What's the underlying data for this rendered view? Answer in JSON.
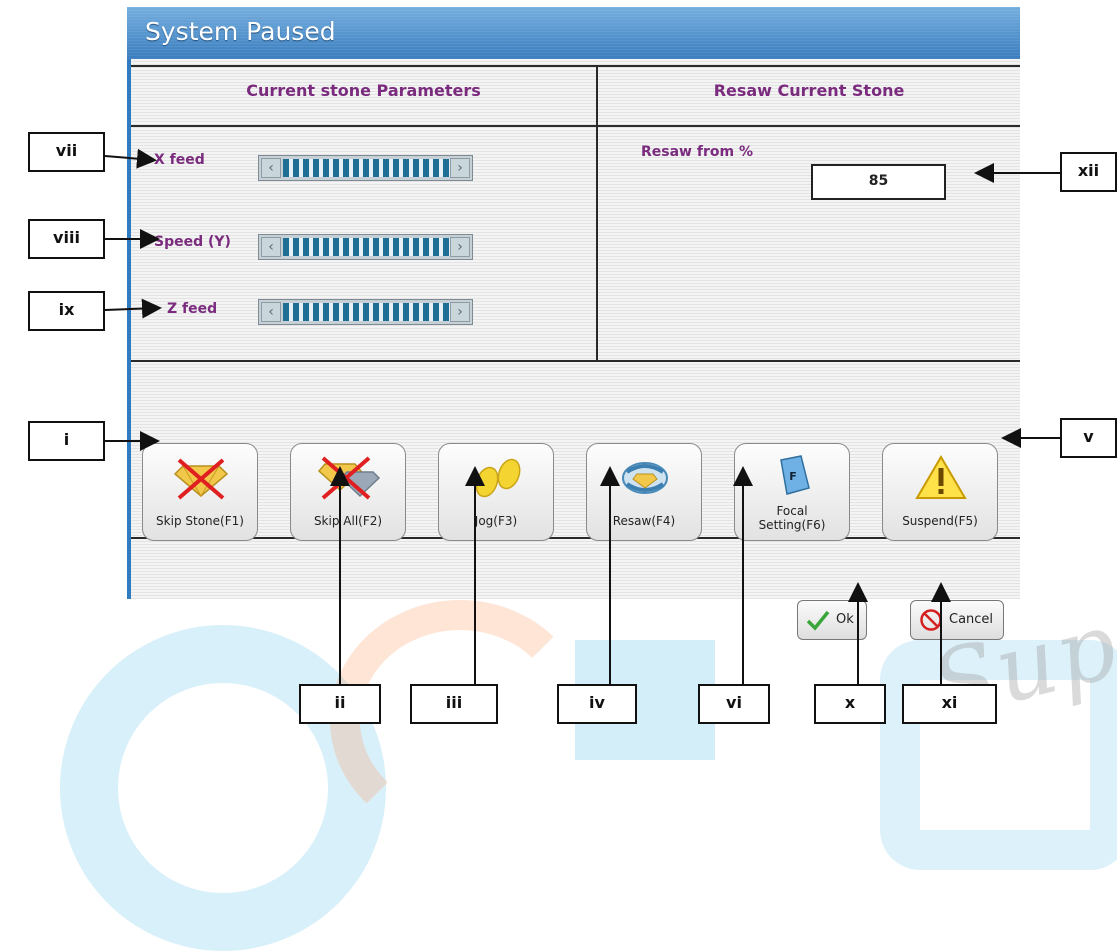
{
  "dialog": {
    "title": "System Paused",
    "left_header": "Current stone Parameters",
    "right_header": "Resaw Current Stone"
  },
  "parameters": [
    {
      "label": "X feed"
    },
    {
      "label": "Speed (Y)"
    },
    {
      "label": "Z feed"
    }
  ],
  "resaw": {
    "label": "Resaw from %",
    "value": "85"
  },
  "toolbar": [
    {
      "label": "Skip Stone(F1)",
      "icon": "skip-stone-icon"
    },
    {
      "label": "Skip All(F2)",
      "icon": "skip-all-icon"
    },
    {
      "label": "Jog(F3)",
      "icon": "footprints-icon"
    },
    {
      "label": "Resaw(F4)",
      "icon": "resaw-icon"
    },
    {
      "label": "Focal\nSetting(F6)",
      "icon": "focal-setting-icon"
    },
    {
      "label": "Suspend(F5)",
      "icon": "warning-icon"
    }
  ],
  "actions": {
    "ok_label": "Ok",
    "cancel_label": "Cancel"
  },
  "callouts": {
    "i": "i",
    "ii": "ii",
    "iii": "iii",
    "iv": "iv",
    "v": "v",
    "vi": "vi",
    "vii": "vii",
    "viii": "viii",
    "ix": "ix",
    "x": "x",
    "xi": "xi",
    "xii": "xii"
  },
  "colors": {
    "title_bar": "#4d8fcc",
    "accent_text": "#7a2b7e",
    "slider_fill": "#1f6e93"
  }
}
